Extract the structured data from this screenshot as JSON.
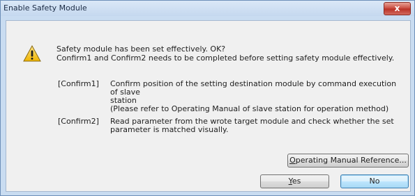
{
  "window": {
    "title": "Enable Safety Module",
    "close_glyph": "x"
  },
  "message": {
    "icon": "warning-icon",
    "line1": "Safety module has been set effectively. OK?",
    "line2": "Confirm1 and Confirm2 needs to be completed before setting safety module effectively."
  },
  "confirm1": {
    "label": "[Confirm1]",
    "line1": "Confirm position of the setting destination module by command execution of slave",
    "line2": "station",
    "line3": "(Please refer to Operating Manual of slave station for operation method)"
  },
  "confirm2": {
    "label": "[Confirm2]",
    "line1": "Read parameter from the wrote target module and check whether the set",
    "line2": "parameter is matched visually."
  },
  "buttons": {
    "manual_access": "O",
    "manual_rest": "perating Manual Reference...",
    "yes_access": "Y",
    "yes_rest": "es",
    "no": "No"
  }
}
